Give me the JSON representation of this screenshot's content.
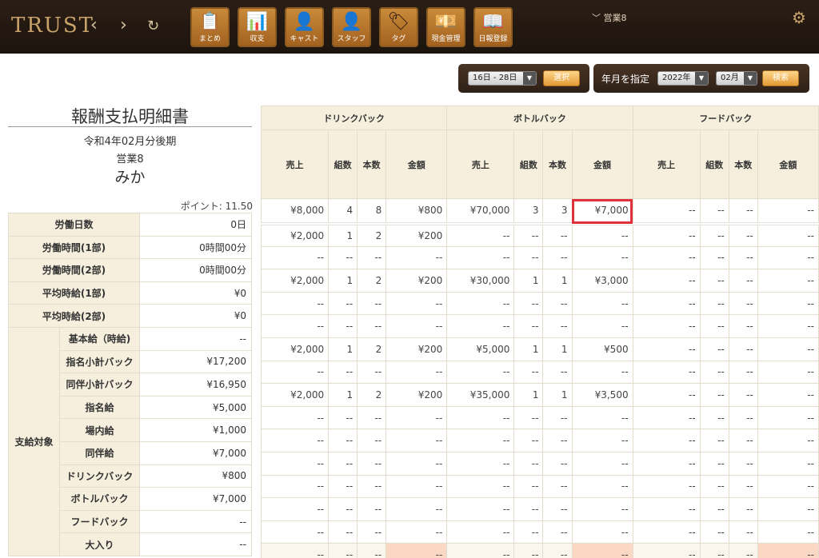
{
  "header": {
    "logo": "TRUST",
    "back": "‹",
    "forward": "›",
    "reload": "↻",
    "tabs": [
      {
        "icon": "📋",
        "label": "まとめ"
      },
      {
        "icon": "📊",
        "label": "収支"
      },
      {
        "icon": "👤",
        "label": "キャスト"
      },
      {
        "icon": "👤",
        "label": "スタッフ"
      },
      {
        "icon": "🏷",
        "label": "タグ"
      },
      {
        "icon": "💴",
        "label": "現金管理"
      },
      {
        "icon": "📖",
        "label": "日報登録"
      }
    ],
    "user_menu": "営業8",
    "user_chevron": "﹀",
    "settings_icon": "⚙"
  },
  "filters": {
    "range_value": "16日 - 28日",
    "range_btn": "選択",
    "ym_label": "年月を指定",
    "year_value": "2022年",
    "month_value": "02月",
    "search_btn": "検索",
    "dd": "▼"
  },
  "statement": {
    "title": "報酬支払明細書",
    "period": "令和4年02月分後期",
    "staff": "営業8",
    "cast": "みか",
    "points": "ポイント: 11.50"
  },
  "summary": {
    "rows": [
      {
        "label": "労働日数",
        "value": "0日"
      },
      {
        "label": "労働時間(1部)",
        "value": "0時間00分"
      },
      {
        "label": "労働時間(2部)",
        "value": "0時間00分"
      },
      {
        "label": "平均時給(1部)",
        "value": "¥0"
      },
      {
        "label": "平均時給(2部)",
        "value": "¥0"
      }
    ],
    "group_label": "支給対象",
    "items": [
      {
        "label": "基本給（時給)",
        "value": "--"
      },
      {
        "label": "指名小計バック",
        "value": "¥17,200"
      },
      {
        "label": "同伴小計バック",
        "value": "¥16,950"
      },
      {
        "label": "指名給",
        "value": "¥5,000"
      },
      {
        "label": "場内給",
        "value": "¥1,000"
      },
      {
        "label": "同伴給",
        "value": "¥7,000"
      },
      {
        "label": "ドリンクバック",
        "value": "¥800"
      },
      {
        "label": "ボトルバック",
        "value": "¥7,000"
      },
      {
        "label": "フードバック",
        "value": "--"
      },
      {
        "label": "大入り",
        "value": "--"
      }
    ]
  },
  "detail": {
    "groups": [
      "ドリンクバック",
      "ボトルバック",
      "フードバック"
    ],
    "columns": [
      "売上",
      "組数",
      "本数",
      "金額",
      "売上",
      "組数",
      "本数",
      "金額",
      "売上",
      "組数",
      "本数",
      "金額"
    ],
    "total": [
      "¥8,000",
      "4",
      "8",
      "¥800",
      "¥70,000",
      "3",
      "3",
      "¥7,000",
      "--",
      "--",
      "--",
      "--"
    ],
    "rows": [
      [
        "¥2,000",
        "1",
        "2",
        "¥200",
        "--",
        "--",
        "--",
        "--",
        "--",
        "--",
        "--",
        "--"
      ],
      [
        "--",
        "--",
        "--",
        "--",
        "--",
        "--",
        "--",
        "--",
        "--",
        "--",
        "--",
        "--"
      ],
      [
        "¥2,000",
        "1",
        "2",
        "¥200",
        "¥30,000",
        "1",
        "1",
        "¥3,000",
        "--",
        "--",
        "--",
        "--"
      ],
      [
        "--",
        "--",
        "--",
        "--",
        "--",
        "--",
        "--",
        "--",
        "--",
        "--",
        "--",
        "--"
      ],
      [
        "--",
        "--",
        "--",
        "--",
        "--",
        "--",
        "--",
        "--",
        "--",
        "--",
        "--",
        "--"
      ],
      [
        "¥2,000",
        "1",
        "2",
        "¥200",
        "¥5,000",
        "1",
        "1",
        "¥500",
        "--",
        "--",
        "--",
        "--"
      ],
      [
        "--",
        "--",
        "--",
        "--",
        "--",
        "--",
        "--",
        "--",
        "--",
        "--",
        "--",
        "--"
      ],
      [
        "¥2,000",
        "1",
        "2",
        "¥200",
        "¥35,000",
        "1",
        "1",
        "¥3,500",
        "--",
        "--",
        "--",
        "--"
      ],
      [
        "--",
        "--",
        "--",
        "--",
        "--",
        "--",
        "--",
        "--",
        "--",
        "--",
        "--",
        "--"
      ],
      [
        "--",
        "--",
        "--",
        "--",
        "--",
        "--",
        "--",
        "--",
        "--",
        "--",
        "--",
        "--"
      ],
      [
        "--",
        "--",
        "--",
        "--",
        "--",
        "--",
        "--",
        "--",
        "--",
        "--",
        "--",
        "--"
      ],
      [
        "--",
        "--",
        "--",
        "--",
        "--",
        "--",
        "--",
        "--",
        "--",
        "--",
        "--",
        "--"
      ],
      [
        "--",
        "--",
        "--",
        "--",
        "--",
        "--",
        "--",
        "--",
        "--",
        "--",
        "--",
        "--"
      ],
      [
        "--",
        "--",
        "--",
        "--",
        "--",
        "--",
        "--",
        "--",
        "--",
        "--",
        "--",
        "--"
      ]
    ],
    "footer": [
      "--",
      "--",
      "--",
      "--",
      "--",
      "--",
      "--",
      "--",
      "--",
      "--",
      "--",
      "--"
    ],
    "highlight_color": "#e0303a"
  }
}
